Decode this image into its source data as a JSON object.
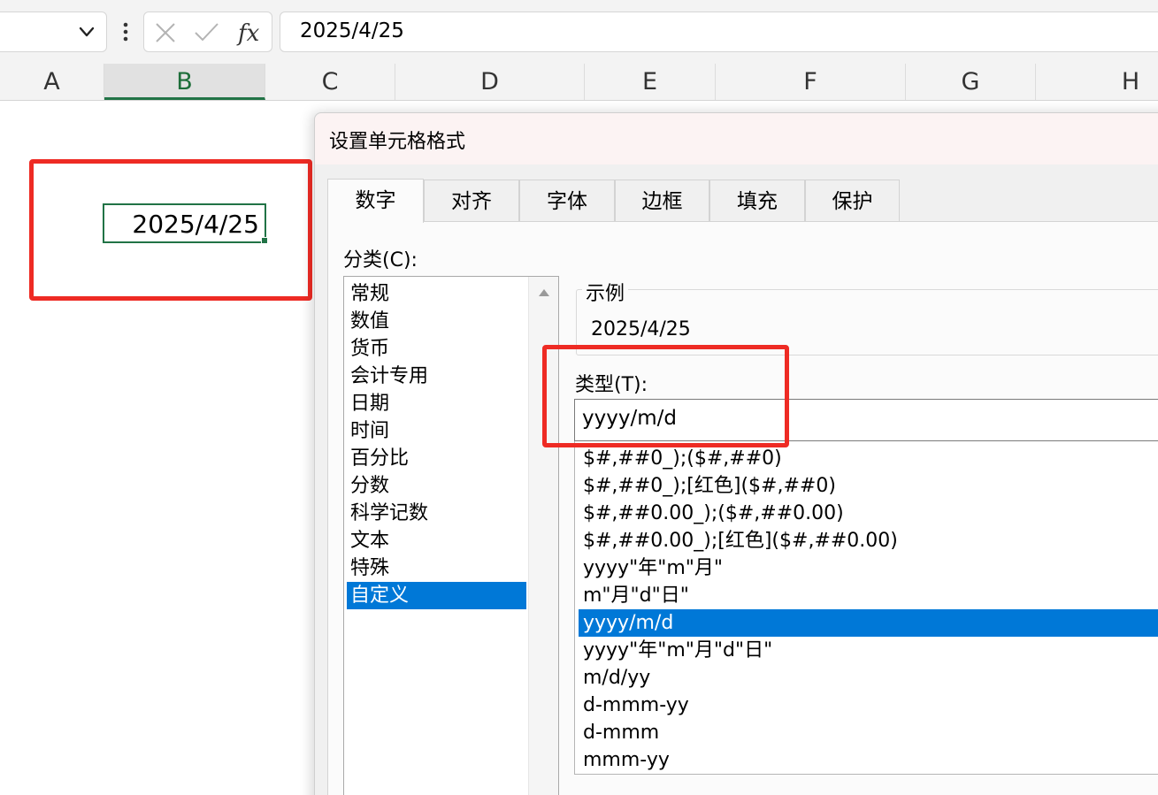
{
  "formula_bar": {
    "name_box_value": "",
    "formula_value": "2025/4/25",
    "icons": [
      "chevron-down-icon",
      "more-vertical-icon",
      "cancel-x-icon",
      "enter-check-icon",
      "insert-function-fx-icon"
    ]
  },
  "columns": [
    "A",
    "B",
    "C",
    "D",
    "E",
    "F",
    "G",
    "H"
  ],
  "selected_column": "B",
  "active_cell": {
    "value": "2025/4/25"
  },
  "dialog": {
    "title": "设置单元格格式",
    "tabs": [
      "数字",
      "对齐",
      "字体",
      "边框",
      "填充",
      "保护"
    ],
    "active_tab": "数字",
    "category_label": "分类(C):",
    "categories": [
      "常规",
      "数值",
      "货币",
      "会计专用",
      "日期",
      "时间",
      "百分比",
      "分数",
      "科学记数",
      "文本",
      "特殊",
      "自定义"
    ],
    "selected_category": "自定义",
    "sample_label": "示例",
    "sample_value": "2025/4/25",
    "type_label": "类型(T):",
    "type_value": "yyyy/m/d",
    "type_list": [
      "$#,##0_);($#,##0)",
      "$#,##0_);[红色]($#,##0)",
      "$#,##0.00_);($#,##0.00)",
      "$#,##0.00_);[红色]($#,##0.00)",
      "yyyy\"年\"m\"月\"",
      "m\"月\"d\"日\"",
      "yyyy/m/d",
      "yyyy\"年\"m\"月\"d\"日\"",
      "m/d/yy",
      "d-mmm-yy",
      "d-mmm",
      "mmm-yy"
    ],
    "selected_type": "yyyy/m/d"
  },
  "colors": {
    "accent_green": "#217346",
    "selection_blue": "#0078d7",
    "annotation_red": "#ee2b24",
    "ribbon_gray": "#f3f3f3"
  }
}
